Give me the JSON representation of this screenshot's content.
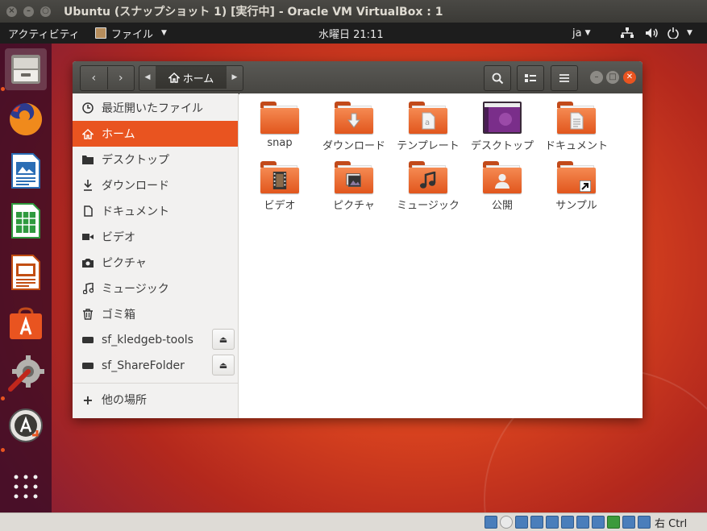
{
  "host": {
    "title": "Ubuntu (スナップショット 1) [実行中] - Oracle VM VirtualBox : 1",
    "buttons": [
      "×",
      "–",
      "○"
    ]
  },
  "topbar": {
    "activities": "アクティビティ",
    "app_menu": "ファイル",
    "clock": "水曜日 21:11",
    "lang": "ja"
  },
  "dock": {
    "items": [
      "files-icon",
      "firefox-icon",
      "writer-icon",
      "calc-icon",
      "impress-icon",
      "software-icon",
      "settings-icon",
      "updater-icon",
      "show-apps-icon"
    ]
  },
  "file_manager": {
    "path": "ホーム",
    "sidebar": {
      "items": [
        {
          "label": "最近開いたファイル",
          "icon": "clock-icon"
        },
        {
          "label": "ホーム",
          "icon": "home-icon",
          "selected": true
        },
        {
          "label": "デスクトップ",
          "icon": "folder-icon"
        },
        {
          "label": "ダウンロード",
          "icon": "download-icon"
        },
        {
          "label": "ドキュメント",
          "icon": "document-icon"
        },
        {
          "label": "ビデオ",
          "icon": "video-icon"
        },
        {
          "label": "ピクチャ",
          "icon": "camera-icon"
        },
        {
          "label": "ミュージック",
          "icon": "music-icon"
        },
        {
          "label": "ゴミ箱",
          "icon": "trash-icon"
        },
        {
          "label": "sf_kledgeb-tools",
          "icon": "drive-icon",
          "eject": true
        },
        {
          "label": "sf_ShareFolder",
          "icon": "drive-icon",
          "eject": true
        },
        {
          "label": "他の場所",
          "icon": "plus-icon"
        }
      ]
    },
    "folders": [
      {
        "label": "snap",
        "icon": "folder-icon"
      },
      {
        "label": "ダウンロード",
        "icon": "download-folder-icon"
      },
      {
        "label": "テンプレート",
        "icon": "templates-folder-icon"
      },
      {
        "label": "デスクトップ",
        "icon": "desktop-folder-icon"
      },
      {
        "label": "ドキュメント",
        "icon": "documents-folder-icon"
      },
      {
        "label": "ビデオ",
        "icon": "videos-folder-icon"
      },
      {
        "label": "ピクチャ",
        "icon": "pictures-folder-icon"
      },
      {
        "label": "ミュージック",
        "icon": "music-folder-icon"
      },
      {
        "label": "公開",
        "icon": "public-folder-icon"
      },
      {
        "label": "サンプル",
        "icon": "examples-folder-icon"
      }
    ]
  },
  "statusbar": {
    "host_key": "右 Ctrl"
  },
  "colors": {
    "accent": "#e95420",
    "topbar": "#1d1d1d",
    "titlebar": "#3c3b37"
  }
}
